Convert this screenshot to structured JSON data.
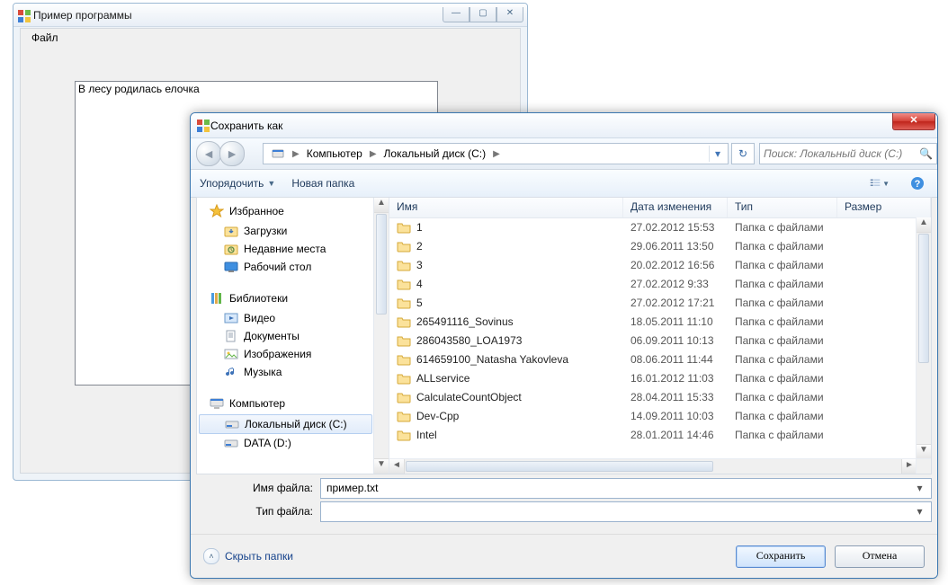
{
  "app": {
    "title": "Пример программы",
    "menu_file": "Файл",
    "textarea_value": "В лесу родилась елочка",
    "win_min": "—",
    "win_max": "▢",
    "win_close": "✕"
  },
  "dialog": {
    "title": "Сохранить как",
    "close_glyph": "✕",
    "breadcrumb": [
      "Компьютер",
      "Локальный диск (C:)"
    ],
    "search_placeholder": "Поиск: Локальный диск (C:)",
    "toolbar": {
      "organize": "Упорядочить",
      "new_folder": "Новая папка"
    },
    "tree": {
      "favorites": "Избранное",
      "fav_items": [
        "Загрузки",
        "Недавние места",
        "Рабочий стол"
      ],
      "libraries": "Библиотеки",
      "lib_items": [
        "Видео",
        "Документы",
        "Изображения",
        "Музыка"
      ],
      "computer": "Компьютер",
      "comp_items": [
        "Локальный диск (C:)",
        "DATA (D:)"
      ]
    },
    "columns": {
      "name": "Имя",
      "date": "Дата изменения",
      "type": "Тип",
      "size": "Размер"
    },
    "folder_type": "Папка с файлами",
    "rows": [
      {
        "name": "1",
        "date": "27.02.2012 15:53"
      },
      {
        "name": "2",
        "date": "29.06.2011 13:50"
      },
      {
        "name": "3",
        "date": "20.02.2012 16:56"
      },
      {
        "name": "4",
        "date": "27.02.2012 9:33"
      },
      {
        "name": "5",
        "date": "27.02.2012 17:21"
      },
      {
        "name": "265491116_Sovinus",
        "date": "18.05.2011 11:10"
      },
      {
        "name": "286043580_LOA1973",
        "date": "06.09.2011 10:13"
      },
      {
        "name": "614659100_Natasha Yakovleva",
        "date": "08.06.2011 11:44"
      },
      {
        "name": "ALLservice",
        "date": "16.01.2012 11:03"
      },
      {
        "name": "CalculateCountObject",
        "date": "28.04.2011 15:33"
      },
      {
        "name": "Dev-Cpp",
        "date": "14.09.2011 10:03"
      },
      {
        "name": "Intel",
        "date": "28.01.2011 14:46"
      }
    ],
    "filename_label": "Имя файла:",
    "filetype_label": "Тип файла:",
    "filename_value": "пример.txt",
    "filetype_value": "",
    "hide_folders": "Скрыть папки",
    "save": "Сохранить",
    "cancel": "Отмена"
  }
}
